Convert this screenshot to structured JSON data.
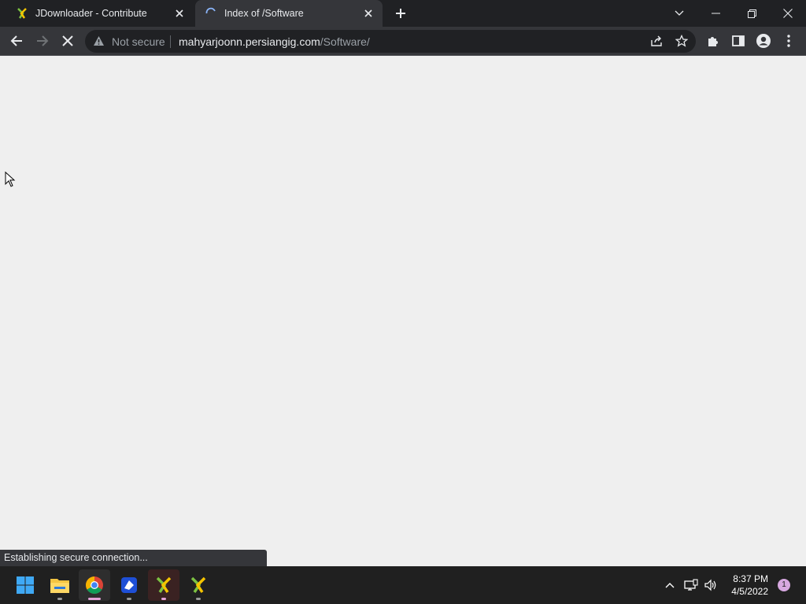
{
  "browser": {
    "tabs": [
      {
        "title": "JDownloader - Contribute",
        "icon": "jdownloader-icon",
        "active": false
      },
      {
        "title": "Index of /Software",
        "icon": "loading-spinner-icon",
        "active": true
      }
    ],
    "omnibox": {
      "security_label": "Not secure",
      "url_host": "mahyarjoonn.persiangig.com",
      "url_path": "/Software/"
    },
    "status_text": "Establishing secure connection..."
  },
  "taskbar": {
    "apps": [
      "start-icon",
      "file-explorer-icon",
      "chrome-icon",
      "app-icon",
      "jdownloader-icon",
      "jdownloader-icon"
    ],
    "time": "8:37 PM",
    "date": "4/5/2022",
    "notification_count": "1"
  },
  "colors": {
    "titlebar": "#202124",
    "toolbar": "#35363a",
    "page_background": "#efefef",
    "taskbar": "#202020"
  }
}
